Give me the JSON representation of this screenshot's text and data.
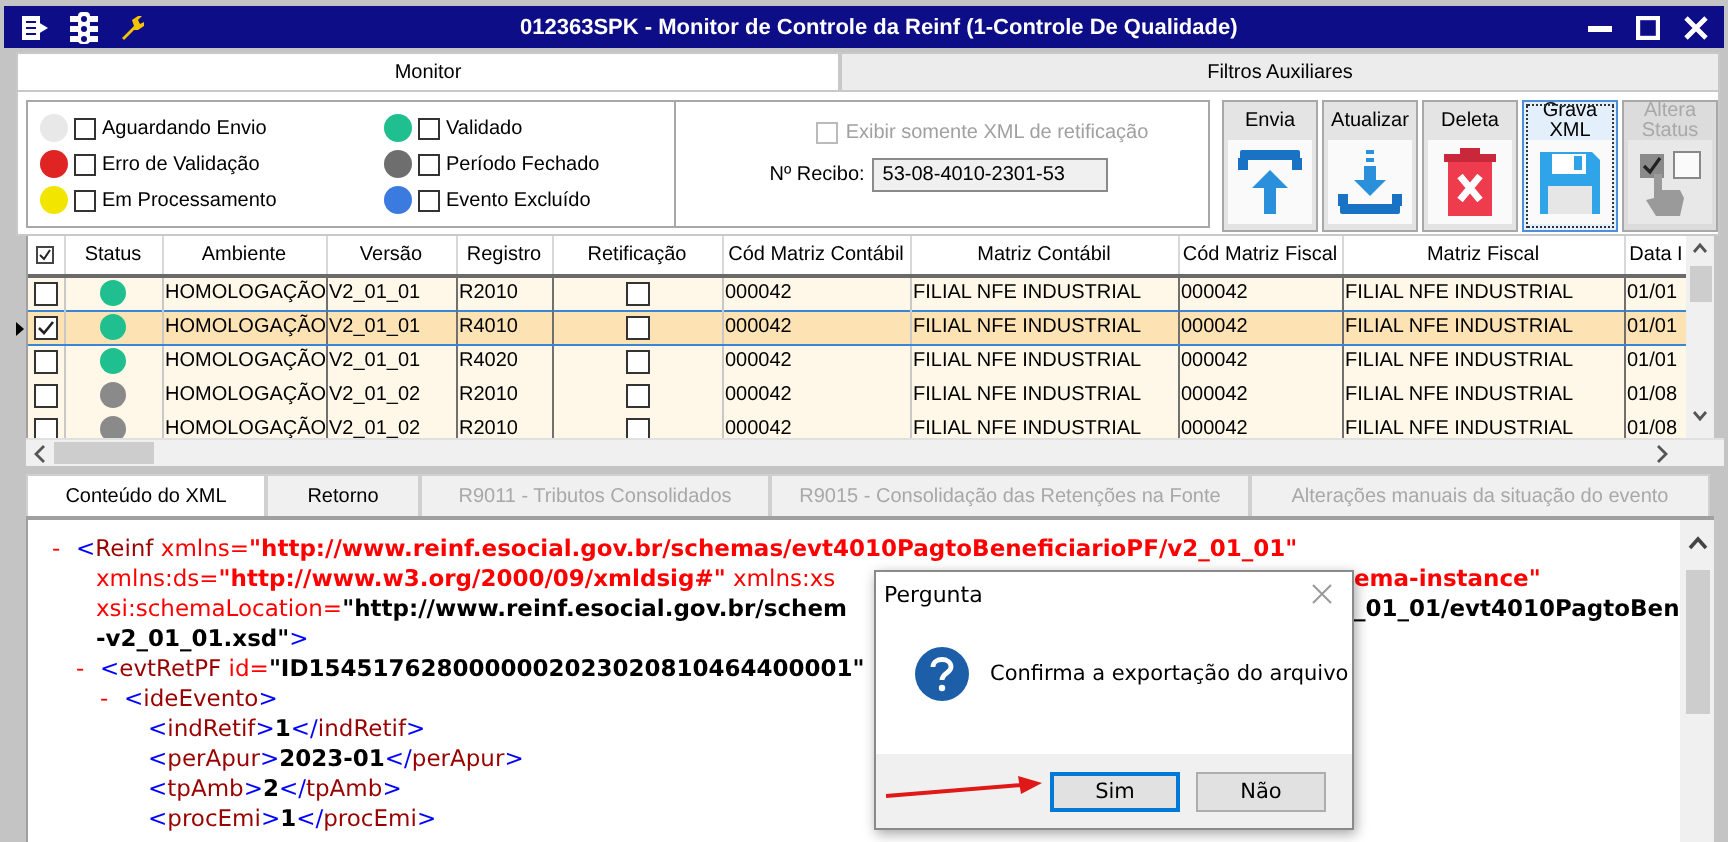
{
  "window": {
    "title": "012363SPK - Monitor de Controle da Reinf (1-Controle De Qualidade)"
  },
  "main_tabs": [
    {
      "label": "Monitor",
      "selected": true
    },
    {
      "label": "Filtros Auxiliares",
      "selected": false
    }
  ],
  "legend": [
    {
      "label": "Aguardando Envio",
      "color": "#e8e8e8",
      "checked": false
    },
    {
      "label": "Erro de Validação",
      "color": "#e02424",
      "checked": false
    },
    {
      "label": "Em Processamento",
      "color": "#f2e600",
      "checked": false
    },
    {
      "label": "Validado",
      "color": "#1fbf8f",
      "checked": false
    },
    {
      "label": "Período Fechado",
      "color": "#6e6e6e",
      "checked": false
    },
    {
      "label": "Evento Excluído",
      "color": "#3b7be0",
      "checked": false
    }
  ],
  "retification_filter": {
    "label": "Exibir somente XML de retificação",
    "checked": false,
    "disabled": true
  },
  "receipt": {
    "label": "Nº Recibo:",
    "value": "53-08-4010-2301-53"
  },
  "toolbar": [
    {
      "label": "Envia",
      "kind": "upload",
      "disabled": false,
      "focused": false
    },
    {
      "label": "Atualizar",
      "kind": "download",
      "disabled": false,
      "focused": false
    },
    {
      "label": "Deleta",
      "kind": "delete",
      "disabled": false,
      "focused": false
    },
    {
      "label": "Grava XML",
      "kind": "save",
      "disabled": false,
      "focused": true
    },
    {
      "label": "Altera Status",
      "kind": "status",
      "disabled": true,
      "focused": false
    }
  ],
  "grid": {
    "columns": [
      "Status",
      "Ambiente",
      "Versão",
      "Registro",
      "Retificação",
      "Cód Matriz Contábil",
      "Matriz Contábil",
      "Cód Matriz Fiscal",
      "Matriz Fiscal",
      "Data I"
    ],
    "rows": [
      {
        "checked": false,
        "selected": false,
        "color": "#1fbf8f",
        "ambiente": "HOMOLOGAÇÃO",
        "versao": "V2_01_01",
        "registro": "R2010",
        "retificacao": false,
        "cod_matriz_contabil": "000042",
        "matriz_contabil": "FILIAL NFE INDUSTRIAL",
        "cod_matriz_fiscal": "000042",
        "matriz_fiscal": "FILIAL NFE INDUSTRIAL",
        "data": "01/01"
      },
      {
        "checked": true,
        "selected": true,
        "color": "#1fbf8f",
        "ambiente": "HOMOLOGAÇÃO",
        "versao": "V2_01_01",
        "registro": "R4010",
        "retificacao": false,
        "cod_matriz_contabil": "000042",
        "matriz_contabil": "FILIAL NFE INDUSTRIAL",
        "cod_matriz_fiscal": "000042",
        "matriz_fiscal": "FILIAL NFE INDUSTRIAL",
        "data": "01/01"
      },
      {
        "checked": false,
        "selected": false,
        "color": "#1fbf8f",
        "ambiente": "HOMOLOGAÇÃO",
        "versao": "V2_01_01",
        "registro": "R4020",
        "retificacao": false,
        "cod_matriz_contabil": "000042",
        "matriz_contabil": "FILIAL NFE INDUSTRIAL",
        "cod_matriz_fiscal": "000042",
        "matriz_fiscal": "FILIAL NFE INDUSTRIAL",
        "data": "01/01"
      },
      {
        "checked": false,
        "selected": false,
        "color": "#8a8a8a",
        "ambiente": "HOMOLOGAÇÃO",
        "versao": "V2_01_02",
        "registro": "R2010",
        "retificacao": false,
        "cod_matriz_contabil": "000042",
        "matriz_contabil": "FILIAL NFE INDUSTRIAL",
        "cod_matriz_fiscal": "000042",
        "matriz_fiscal": "FILIAL NFE INDUSTRIAL",
        "data": "01/08"
      },
      {
        "checked": false,
        "selected": false,
        "color": "#8a8a8a",
        "ambiente": "HOMOLOGAÇÃO",
        "versao": "V2_01_02",
        "registro": "R2010",
        "retificacao": false,
        "cod_matriz_contabil": "000042",
        "matriz_contabil": "FILIAL NFE INDUSTRIAL",
        "cod_matriz_fiscal": "000042",
        "matriz_fiscal": "FILIAL NFE INDUSTRIAL",
        "data": "01/08"
      }
    ]
  },
  "detail_tabs": [
    {
      "label": "Conteúdo do XML",
      "selected": true,
      "disabled": false
    },
    {
      "label": "Retorno",
      "selected": false,
      "disabled": false
    },
    {
      "label": "R9011 - Tributos Consolidados",
      "selected": false,
      "disabled": true
    },
    {
      "label": "R9015 - Consolidação das Retenções na Fonte",
      "selected": false,
      "disabled": true
    },
    {
      "label": "Alterações manuais da situação do evento",
      "selected": false,
      "disabled": true
    }
  ],
  "xml": [
    {
      "toggle": "-",
      "lines": [
        {
          "segments": [
            {
              "kind": "bracket",
              "text": "<"
            },
            {
              "kind": "tag",
              "text": "Reinf"
            },
            {
              "kind": "attr",
              "text": " xmlns="
            },
            {
              "kind": "nsvalue",
              "text": "\"http://www.reinf.esocial.gov.br/schemas/evt4010PagtoBeneficiarioPF/v2_01_01\""
            }
          ]
        },
        {
          "segments": [
            {
              "kind": "attr",
              "text": "xmlns:ds="
            },
            {
              "kind": "nsvalue",
              "text": "\"http://www.w3.org/2000/09/xmldsig#\""
            },
            {
              "kind": "attr",
              "text": " xmlns:xs"
            }
          ],
          "after_dialog": [
            {
              "kind": "nsvalue",
              "text": "ema-instance\""
            }
          ]
        },
        {
          "segments": [
            {
              "kind": "attr",
              "text": "xsi:schemaLocation="
            },
            {
              "kind": "value",
              "text": "\"http://www.reinf.esocial.gov.br/schem"
            }
          ],
          "after_dialog": [
            {
              "kind": "value",
              "text": "_01_01/evt4010PagtoBen"
            }
          ]
        },
        {
          "segments": [
            {
              "kind": "value",
              "text": "-v2_01_01.xsd\""
            },
            {
              "kind": "bracket",
              "text": ">"
            }
          ]
        }
      ],
      "children": [
        {
          "toggle": "-",
          "lines": [
            {
              "segments": [
                {
                  "kind": "bracket",
                  "text": "<"
                },
                {
                  "kind": "tag",
                  "text": "evtRetPF"
                },
                {
                  "kind": "attr",
                  "text": " id="
                },
                {
                  "kind": "value",
                  "text": "\"ID1545176280000002023020810464400001\""
                }
              ]
            }
          ],
          "children": [
            {
              "toggle": "-",
              "lines": [
                {
                  "segments": [
                    {
                      "kind": "bracket",
                      "text": "<"
                    },
                    {
                      "kind": "tag",
                      "text": "ideEvento"
                    },
                    {
                      "kind": "bracket",
                      "text": ">"
                    }
                  ]
                }
              ],
              "children": [
                {
                  "lines": [
                    {
                      "segments": [
                        {
                          "kind": "bracket",
                          "text": "<"
                        },
                        {
                          "kind": "tag",
                          "text": "indRetif"
                        },
                        {
                          "kind": "bracket",
                          "text": ">"
                        },
                        {
                          "kind": "text",
                          "text": "1"
                        },
                        {
                          "kind": "bracket",
                          "text": "</"
                        },
                        {
                          "kind": "tag",
                          "text": "indRetif"
                        },
                        {
                          "kind": "bracket",
                          "text": ">"
                        }
                      ]
                    }
                  ]
                },
                {
                  "lines": [
                    {
                      "segments": [
                        {
                          "kind": "bracket",
                          "text": "<"
                        },
                        {
                          "kind": "tag",
                          "text": "perApur"
                        },
                        {
                          "kind": "bracket",
                          "text": ">"
                        },
                        {
                          "kind": "text",
                          "text": "2023-01"
                        },
                        {
                          "kind": "bracket",
                          "text": "</"
                        },
                        {
                          "kind": "tag",
                          "text": "perApur"
                        },
                        {
                          "kind": "bracket",
                          "text": ">"
                        }
                      ]
                    }
                  ]
                },
                {
                  "lines": [
                    {
                      "segments": [
                        {
                          "kind": "bracket",
                          "text": "<"
                        },
                        {
                          "kind": "tag",
                          "text": "tpAmb"
                        },
                        {
                          "kind": "bracket",
                          "text": ">"
                        },
                        {
                          "kind": "text",
                          "text": "2"
                        },
                        {
                          "kind": "bracket",
                          "text": "</"
                        },
                        {
                          "kind": "tag",
                          "text": "tpAmb"
                        },
                        {
                          "kind": "bracket",
                          "text": ">"
                        }
                      ]
                    }
                  ]
                },
                {
                  "lines": [
                    {
                      "segments": [
                        {
                          "kind": "bracket",
                          "text": "<"
                        },
                        {
                          "kind": "tag",
                          "text": "procEmi"
                        },
                        {
                          "kind": "bracket",
                          "text": ">"
                        },
                        {
                          "kind": "text",
                          "text": "1"
                        },
                        {
                          "kind": "bracket",
                          "text": "</"
                        },
                        {
                          "kind": "tag",
                          "text": "procEmi"
                        },
                        {
                          "kind": "bracket",
                          "text": ">"
                        }
                      ]
                    }
                  ]
                }
              ]
            }
          ]
        }
      ]
    }
  ],
  "dialog": {
    "title": "Pergunta",
    "message": "Confirma a exportação do arquivo",
    "pointer_arrow": true,
    "buttons": [
      {
        "label": "Sim",
        "focused": true
      },
      {
        "label": "Não",
        "focused": false
      }
    ]
  }
}
